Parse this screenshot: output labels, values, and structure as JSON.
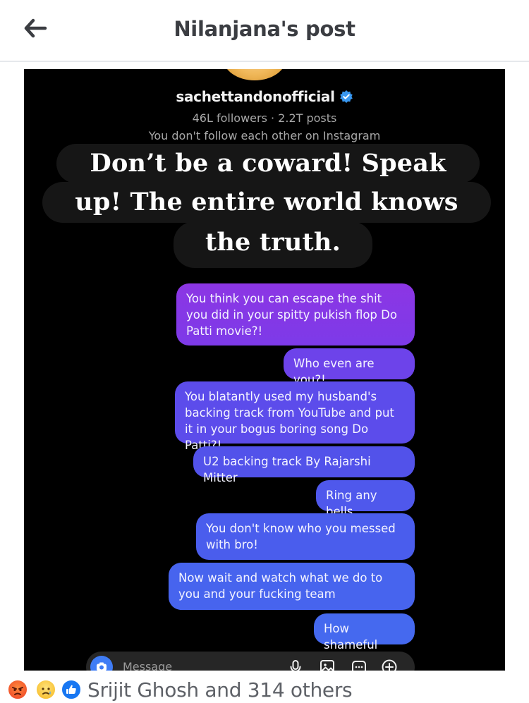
{
  "header": {
    "back_icon": "arrow-left-icon",
    "title": "Nilanjana's post"
  },
  "screenshot": {
    "profile": {
      "username": "sachettandonofficial",
      "verified_icon": "verified-badge-icon",
      "stats": "46L followers · 2.2T posts",
      "follow_status": "You don't follow each other on Instagram"
    },
    "overlay_text": {
      "line1": "Don’t be a coward! Speak",
      "line2": "up! The entire world knows",
      "line3": "the truth."
    },
    "messages": [
      {
        "text": "You think you can escape the shit you did in your spitty pukish flop Do Patti movie?!"
      },
      {
        "text": "Who even are you?!"
      },
      {
        "text": "You blatantly used my husband's backing track from YouTube and put it in your bogus boring song Do Patti?!"
      },
      {
        "text": "U2 backing track By Rajarshi Mitter"
      },
      {
        "text": "Ring any bells"
      },
      {
        "text": "You don't know who you messed with bro!"
      },
      {
        "text": "Now wait and watch what we do to you and your fucking team"
      },
      {
        "text": "How shameful"
      }
    ],
    "composer": {
      "placeholder": "Message",
      "icons": [
        "camera-icon",
        "mic-icon",
        "gallery-icon",
        "sticker-icon",
        "plus-icon"
      ]
    },
    "colors": {
      "bubble_top": "#8c36e4",
      "bubble_bottom": "#4569ef",
      "background": "#000000"
    }
  },
  "reactions": {
    "icons": [
      "angry-reaction-icon",
      "sad-reaction-icon",
      "like-reaction-icon"
    ],
    "text": "Srijit Ghosh and 314 others"
  }
}
